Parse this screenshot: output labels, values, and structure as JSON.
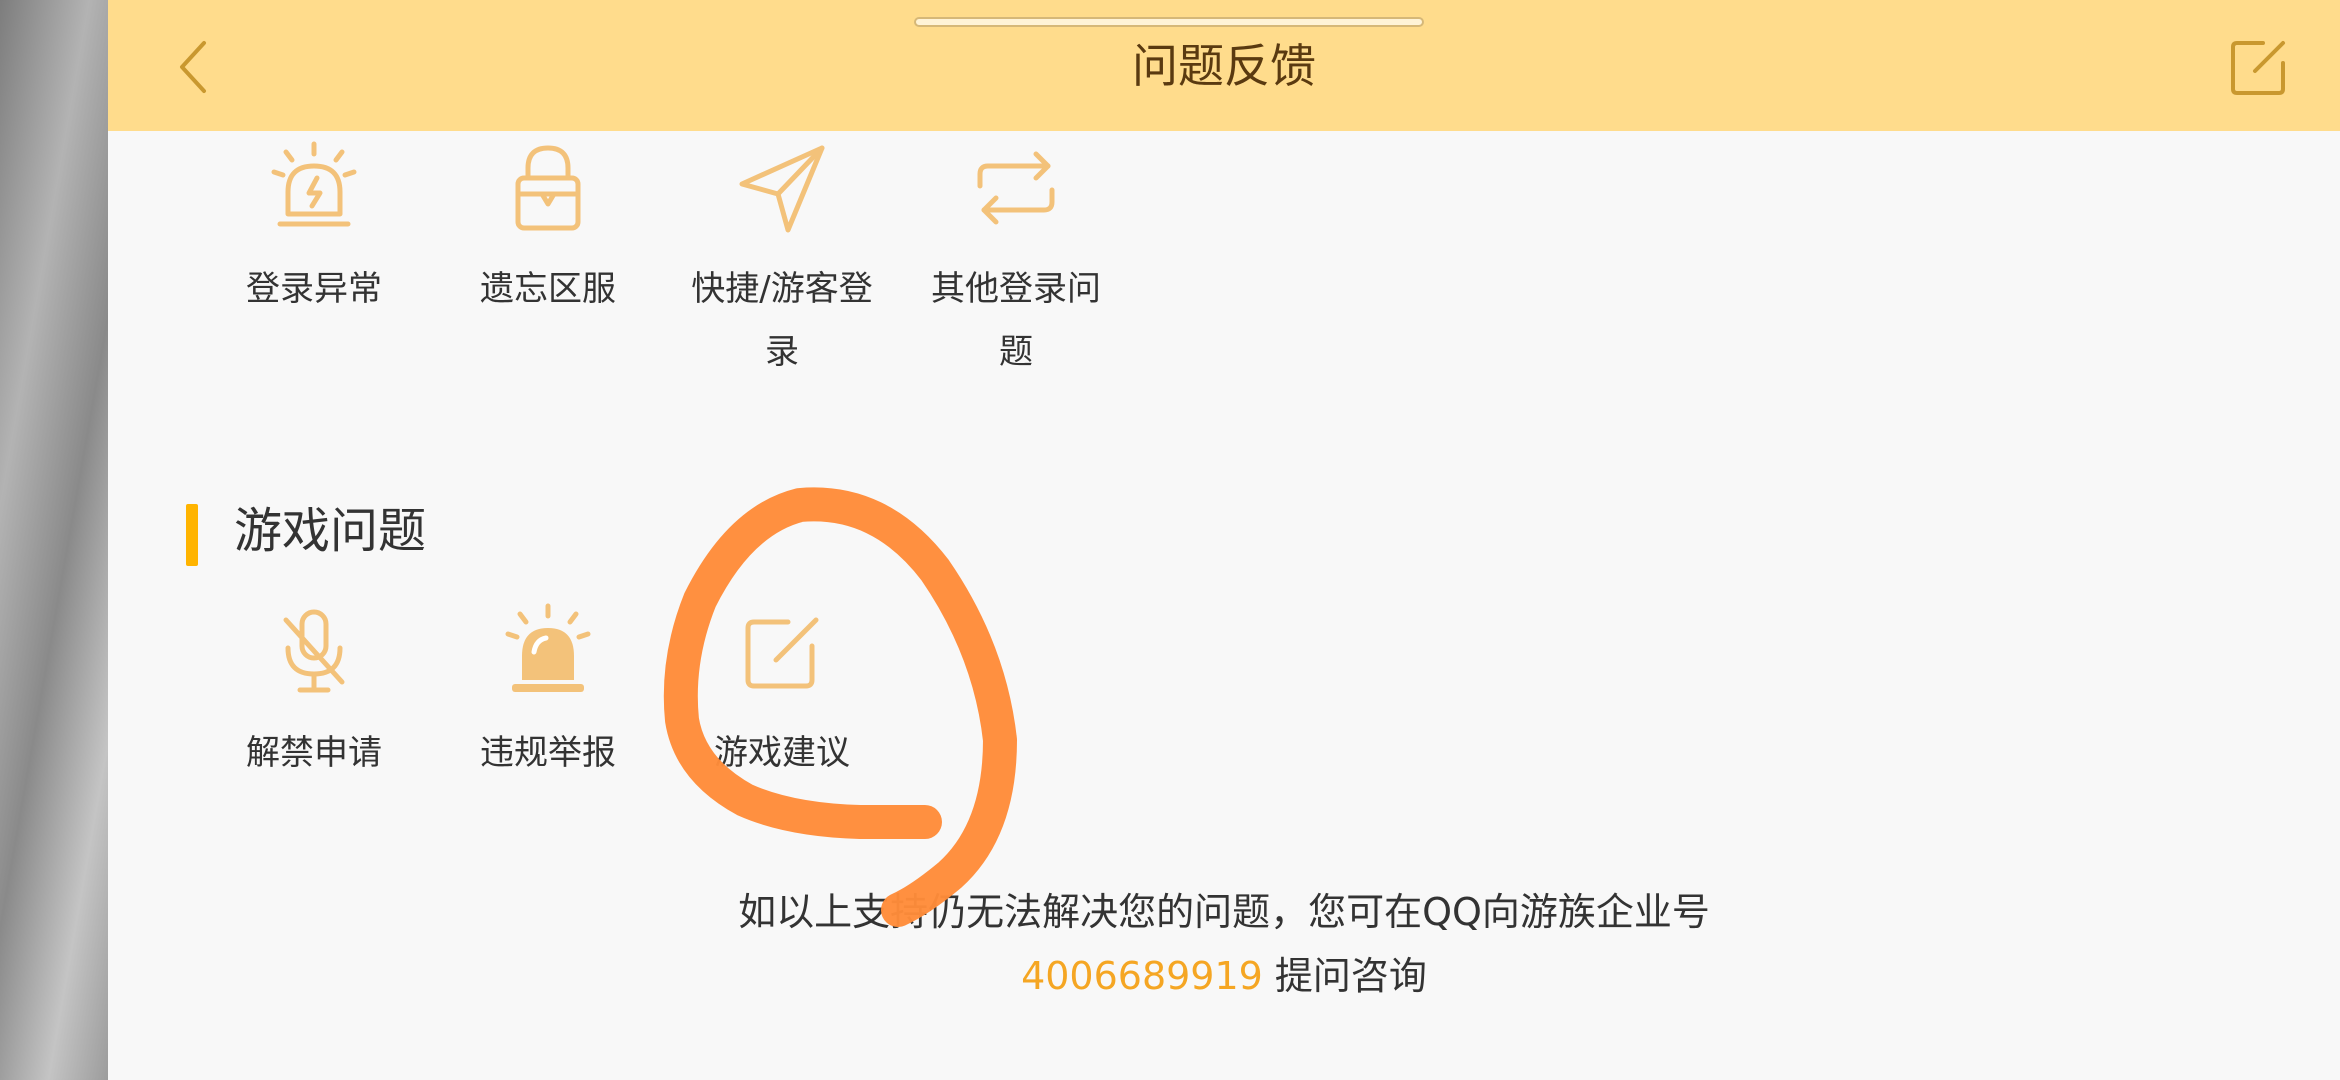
{
  "header": {
    "title": "问题反馈",
    "back_icon": "chevron-left-icon",
    "edit_icon": "edit-square-icon",
    "color": "#ffdc8c"
  },
  "login_items": [
    {
      "label": "登录异常",
      "icon": "alarm-light-icon"
    },
    {
      "label": "遗忘区服",
      "icon": "lock-icon"
    },
    {
      "label": "快捷/游客登\n录",
      "icon": "paper-plane-icon"
    },
    {
      "label": "其他登录问\n题",
      "icon": "swap-arrows-icon"
    }
  ],
  "game_section": {
    "title": "游戏问题",
    "items": [
      {
        "label": "解禁申请",
        "icon": "microphone-muted-icon"
      },
      {
        "label": "违规举报",
        "icon": "siren-icon"
      },
      {
        "label": "游戏建议",
        "icon": "edit-square-icon"
      }
    ]
  },
  "footer": {
    "line1": "如以上支持仍无法解决您的问题，您可在QQ向游族企业号",
    "phone": "4006689919",
    "line2_suffix": " 提问咨询"
  },
  "colors": {
    "accent": "#f5a623",
    "icon": "#f3c27a",
    "section_bar": "#ffb400",
    "annotation": "#ff8c3a"
  }
}
